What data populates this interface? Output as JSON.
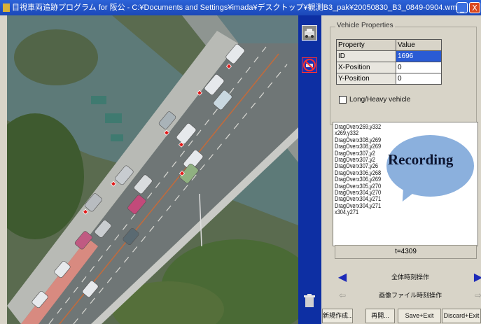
{
  "window": {
    "title": "目視車両追跡プログラム for 阪公 - C:¥Documents and Settings¥imada¥デスクトップ¥観測B3_pak¥20050830_B3_0849-0904.wmv",
    "minimize": "_",
    "close": "X"
  },
  "toolbar": {
    "icons": [
      "car-tool-icon",
      "no-car-tool-icon",
      "trash-icon"
    ]
  },
  "vehicle_properties": {
    "group_title": "Vehicle Properties",
    "header": {
      "property": "Property",
      "value": "Value"
    },
    "rows": [
      {
        "property": "ID",
        "value": "1696"
      },
      {
        "property": "X-Position",
        "value": "0"
      },
      {
        "property": "Y-Position",
        "value": "0"
      }
    ],
    "long_heavy_label": "Long/Heavy vehicle",
    "long_heavy_checked": false
  },
  "log": [
    "DragOverx269,y332",
    "x269,y332",
    "DragOverx308,y269",
    "DragOverx308,y269",
    "DragOverx307,y2",
    "DragOverx307,y2",
    "DragOverx307,y26",
    "DragOverx306,y268",
    "DragOverx306,y269",
    "DragOverx305,y270",
    "DragOverx304,y270",
    "DragOverx304,y271",
    "DragOverx304,y271",
    "x304,y271"
  ],
  "overlay": {
    "recording_text": "Recording",
    "bubble_color": "#8bb0dd"
  },
  "timer": {
    "value": "t=4309"
  },
  "nav": {
    "row1_label": "全体時刻操作",
    "row2_label": "画像ファイル時刻操作",
    "prev_symbol": "◀",
    "next_symbol": "▶"
  },
  "buttons": {
    "new": "新規作成...",
    "replay": "再開...",
    "save_exit": "Save+Exit",
    "discard_exit": "Discard+Exit"
  },
  "colors": {
    "accent": "#0d2fa3",
    "title_bar": "#2c63d8",
    "marker": "#e01a1a"
  }
}
